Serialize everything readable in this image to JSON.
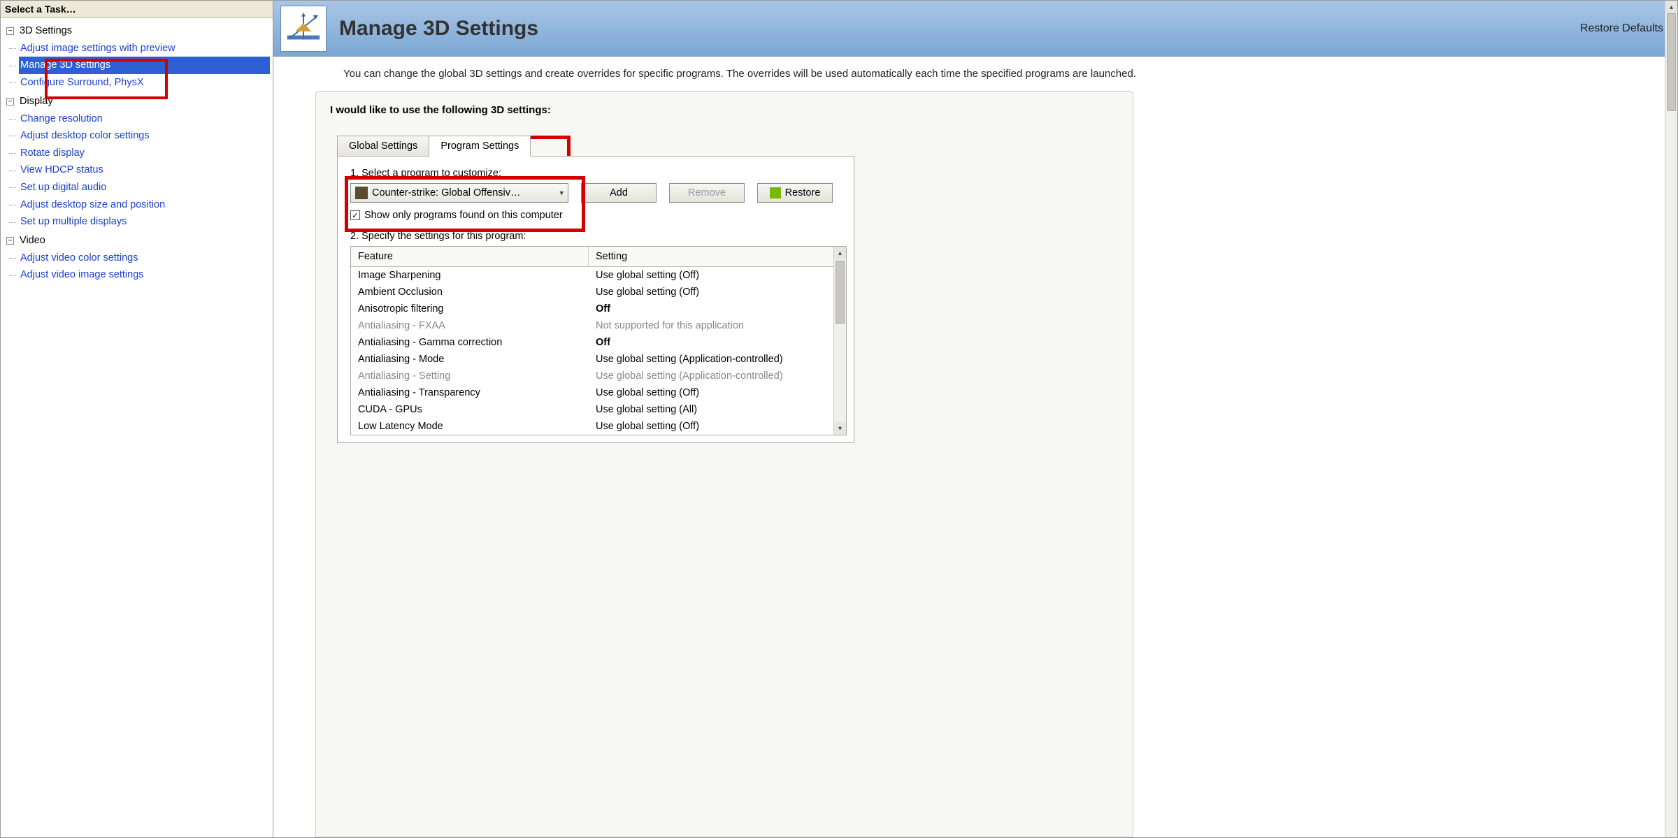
{
  "sidebar": {
    "header": "Select a Task…",
    "groups": [
      {
        "label": "3D Settings",
        "items": [
          "Adjust image settings with preview",
          "Manage 3D settings",
          "Configure Surround, PhysX"
        ],
        "selected_index": 1
      },
      {
        "label": "Display",
        "items": [
          "Change resolution",
          "Adjust desktop color settings",
          "Rotate display",
          "View HDCP status",
          "Set up digital audio",
          "Adjust desktop size and position",
          "Set up multiple displays"
        ]
      },
      {
        "label": "Video",
        "items": [
          "Adjust video color settings",
          "Adjust video image settings"
        ]
      }
    ]
  },
  "header": {
    "title": "Manage 3D Settings",
    "restore": "Restore Defaults"
  },
  "description": "You can change the global 3D settings and create overrides for specific programs. The overrides will be used automatically each time the specified programs are launched.",
  "panel": {
    "heading": "I would like to use the following 3D settings:",
    "tabs": {
      "global": "Global Settings",
      "program": "Program Settings"
    },
    "step1_label": "1. Select a program to customize:",
    "program_select": "Counter-strike: Global Offensiv…",
    "add": "Add",
    "remove": "Remove",
    "restore": "Restore",
    "show_only": "Show only programs found on this computer",
    "step2_label": "2. Specify the settings for this program:",
    "cols": {
      "feature": "Feature",
      "setting": "Setting"
    },
    "rows": [
      {
        "f": "Image Sharpening",
        "s": "Use global setting (Off)"
      },
      {
        "f": "Ambient Occlusion",
        "s": "Use global setting (Off)"
      },
      {
        "f": "Anisotropic filtering",
        "s": "Off",
        "bold": true
      },
      {
        "f": "Antialiasing - FXAA",
        "s": "Not supported for this application",
        "dim": true
      },
      {
        "f": "Antialiasing - Gamma correction",
        "s": "Off",
        "bold": true
      },
      {
        "f": "Antialiasing - Mode",
        "s": "Use global setting (Application-controlled)"
      },
      {
        "f": "Antialiasing - Setting",
        "s": "Use global setting (Application-controlled)",
        "dim": true
      },
      {
        "f": "Antialiasing - Transparency",
        "s": "Use global setting (Off)"
      },
      {
        "f": "CUDA - GPUs",
        "s": "Use global setting (All)"
      },
      {
        "f": "Low Latency Mode",
        "s": "Use global setting (Off)"
      }
    ]
  }
}
